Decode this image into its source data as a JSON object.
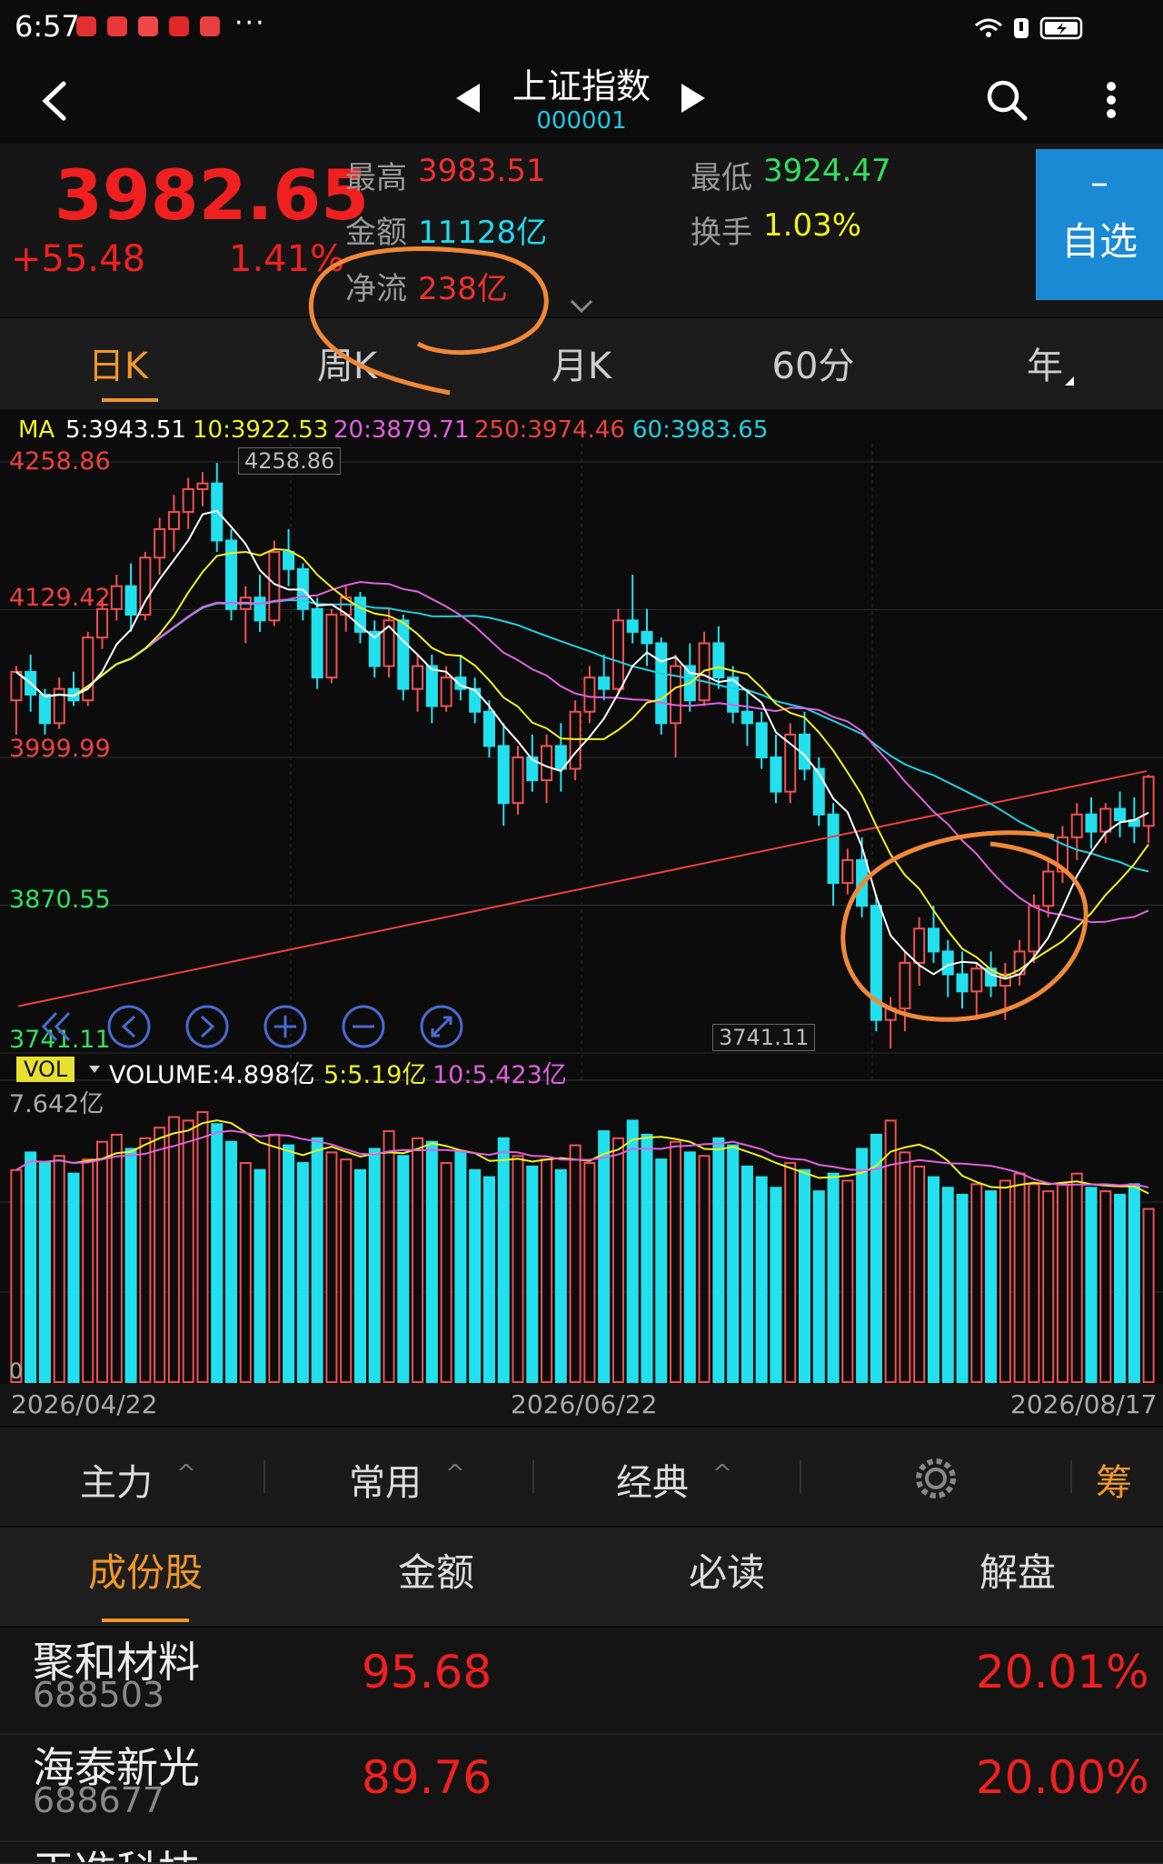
{
  "status": {
    "time": "6:57",
    "dots": "···"
  },
  "header": {
    "title": "上证指数",
    "code": "000001"
  },
  "quote": {
    "price": "3982.65",
    "change": "+55.48",
    "change_pct": "1.41%",
    "high_label": "最高",
    "high": "3983.51",
    "low_label": "最低",
    "low": "3924.47",
    "amount_label": "金额",
    "amount": "11128亿",
    "turnover_label": "换手",
    "turnover": "1.03%",
    "netflow_label": "净流",
    "netflow": "238亿",
    "watch_minus": "–",
    "watch_label": "自选"
  },
  "ktabs": [
    "日K",
    "周K",
    "月K",
    "60分",
    "年"
  ],
  "ma_row": {
    "ma": "MA",
    "ma5": "5:3943.51",
    "ma10": "10:3922.53",
    "ma20": "20:3879.71",
    "ma250": "250:3974.46",
    "ma60": "60:3983.65"
  },
  "chart": {
    "price_axis": [
      "4258.86",
      "4129.42",
      "3999.99",
      "3870.55",
      "3741.11"
    ],
    "max_marker": "4258.86",
    "min_marker": "3741.11",
    "vol_badge": "VOL",
    "vol_readout": "VOLUME:4.898亿",
    "vol5": "5:5.19亿",
    "vol10": "10:5.423亿",
    "vol_max": "7.642亿",
    "vol_zero": "0",
    "dates": [
      "2026/04/22",
      "2026/06/22",
      "2026/08/17"
    ],
    "colors": {
      "up": "#f05050",
      "down": "#22e0ee",
      "ma5": "#ffffff",
      "ma10": "#f0f020",
      "ma20": "#e060e0",
      "ma60": "#20d0e0",
      "ma250": "#f04040"
    }
  },
  "chart_data": {
    "type": "candlestick",
    "ylim": [
      3741.11,
      4258.86
    ],
    "vol_ylim": [
      0,
      7.642
    ],
    "candles": [
      [
        4050,
        4080,
        4020,
        4075
      ],
      [
        4075,
        4090,
        4040,
        4055
      ],
      [
        4055,
        4060,
        4020,
        4030
      ],
      [
        4030,
        4070,
        4025,
        4060
      ],
      [
        4060,
        4075,
        4045,
        4050
      ],
      [
        4050,
        4110,
        4045,
        4105
      ],
      [
        4105,
        4140,
        4095,
        4130
      ],
      [
        4130,
        4160,
        4120,
        4150
      ],
      [
        4150,
        4170,
        4110,
        4125
      ],
      [
        4125,
        4180,
        4120,
        4175
      ],
      [
        4175,
        4210,
        4160,
        4200
      ],
      [
        4200,
        4230,
        4180,
        4215
      ],
      [
        4215,
        4245,
        4200,
        4235
      ],
      [
        4235,
        4250,
        4220,
        4240
      ],
      [
        4240,
        4258,
        4180,
        4190
      ],
      [
        4190,
        4200,
        4120,
        4130
      ],
      [
        4130,
        4150,
        4100,
        4140
      ],
      [
        4140,
        4160,
        4110,
        4120
      ],
      [
        4120,
        4190,
        4115,
        4180
      ],
      [
        4180,
        4200,
        4150,
        4165
      ],
      [
        4165,
        4170,
        4120,
        4130
      ],
      [
        4130,
        4140,
        4060,
        4070
      ],
      [
        4070,
        4130,
        4065,
        4125
      ],
      [
        4125,
        4150,
        4110,
        4140
      ],
      [
        4140,
        4145,
        4100,
        4110
      ],
      [
        4110,
        4120,
        4070,
        4080
      ],
      [
        4080,
        4130,
        4070,
        4120
      ],
      [
        4120,
        4125,
        4050,
        4060
      ],
      [
        4060,
        4090,
        4040,
        4080
      ],
      [
        4080,
        4090,
        4030,
        4045
      ],
      [
        4045,
        4080,
        4040,
        4070
      ],
      [
        4070,
        4090,
        4050,
        4060
      ],
      [
        4060,
        4070,
        4030,
        4040
      ],
      [
        4040,
        4050,
        4000,
        4010
      ],
      [
        4010,
        4030,
        3940,
        3960
      ],
      [
        3960,
        4010,
        3950,
        4000
      ],
      [
        4000,
        4020,
        3970,
        3980
      ],
      [
        3980,
        4020,
        3960,
        4010
      ],
      [
        4010,
        4030,
        3970,
        3990
      ],
      [
        3990,
        4050,
        3980,
        4040
      ],
      [
        4040,
        4080,
        4030,
        4070
      ],
      [
        4070,
        4090,
        4050,
        4060
      ],
      [
        4060,
        4130,
        4055,
        4120
      ],
      [
        4120,
        4160,
        4100,
        4110
      ],
      [
        4110,
        4130,
        4080,
        4100
      ],
      [
        4100,
        4105,
        4020,
        4030
      ],
      [
        4030,
        4090,
        4000,
        4080
      ],
      [
        4080,
        4100,
        4040,
        4050
      ],
      [
        4050,
        4110,
        4045,
        4100
      ],
      [
        4100,
        4115,
        4060,
        4070
      ],
      [
        4070,
        4080,
        4030,
        4040
      ],
      [
        4040,
        4060,
        4010,
        4030
      ],
      [
        4030,
        4040,
        3990,
        4000
      ],
      [
        4000,
        4020,
        3960,
        3970
      ],
      [
        3970,
        4030,
        3960,
        4020
      ],
      [
        4020,
        4040,
        3980,
        3990
      ],
      [
        3990,
        4000,
        3940,
        3950
      ],
      [
        3950,
        3960,
        3870,
        3890
      ],
      [
        3890,
        3920,
        3880,
        3910
      ],
      [
        3910,
        3930,
        3860,
        3870
      ],
      [
        3870,
        3880,
        3760,
        3770
      ],
      [
        3770,
        3790,
        3745,
        3780
      ],
      [
        3780,
        3830,
        3760,
        3820
      ],
      [
        3820,
        3860,
        3800,
        3850
      ],
      [
        3850,
        3870,
        3820,
        3830
      ],
      [
        3830,
        3840,
        3790,
        3810
      ],
      [
        3810,
        3830,
        3780,
        3795
      ],
      [
        3795,
        3820,
        3770,
        3815
      ],
      [
        3815,
        3830,
        3790,
        3800
      ],
      [
        3800,
        3820,
        3770,
        3810
      ],
      [
        3810,
        3840,
        3800,
        3830
      ],
      [
        3830,
        3880,
        3820,
        3870
      ],
      [
        3870,
        3910,
        3860,
        3900
      ],
      [
        3900,
        3940,
        3890,
        3930
      ],
      [
        3930,
        3960,
        3910,
        3950
      ],
      [
        3950,
        3965,
        3920,
        3935
      ],
      [
        3935,
        3960,
        3925,
        3955
      ],
      [
        3955,
        3970,
        3930,
        3945
      ],
      [
        3945,
        3965,
        3925,
        3940
      ],
      [
        3940,
        3985,
        3925,
        3983
      ]
    ],
    "volumes": [
      6.0,
      6.5,
      6.2,
      6.4,
      5.9,
      6.3,
      6.8,
      7.0,
      6.6,
      6.9,
      7.2,
      7.5,
      7.4,
      7.64,
      7.3,
      6.8,
      6.2,
      6.0,
      7.0,
      6.7,
      6.2,
      6.9,
      6.5,
      6.3,
      6.0,
      6.6,
      7.1,
      6.4,
      6.9,
      6.8,
      6.2,
      6.5,
      6.0,
      5.8,
      6.9,
      6.4,
      6.1,
      6.3,
      6.0,
      6.7,
      6.2,
      7.1,
      6.9,
      7.4,
      7.0,
      6.3,
      6.8,
      6.5,
      6.4,
      6.9,
      6.7,
      6.1,
      5.8,
      5.5,
      6.2,
      6.0,
      5.4,
      5.9,
      5.7,
      6.6,
      7.0,
      7.4,
      6.5,
      6.1,
      5.8,
      5.5,
      5.3,
      5.6,
      5.4,
      5.7,
      5.9,
      5.6,
      5.4,
      5.6,
      5.9,
      5.5,
      5.4,
      5.3,
      5.6,
      4.9
    ],
    "dates": [
      "2026/04/22",
      "2026/06/22",
      "2026/08/17"
    ]
  },
  "funcbar": {
    "main": "主力",
    "common": "常用",
    "classic": "经典",
    "chip": "筹",
    "caret": "^"
  },
  "list_tabs": [
    "成份股",
    "金额",
    "必读",
    "解盘"
  ],
  "stocks": [
    {
      "name": "聚和材料",
      "code": "688503",
      "price": "95.68",
      "pct": "20.01%"
    },
    {
      "name": "海泰新光",
      "code": "688677",
      "price": "89.76",
      "pct": "20.00%"
    },
    {
      "name": "天准科技",
      "code": "",
      "price": "",
      "pct": ""
    }
  ]
}
